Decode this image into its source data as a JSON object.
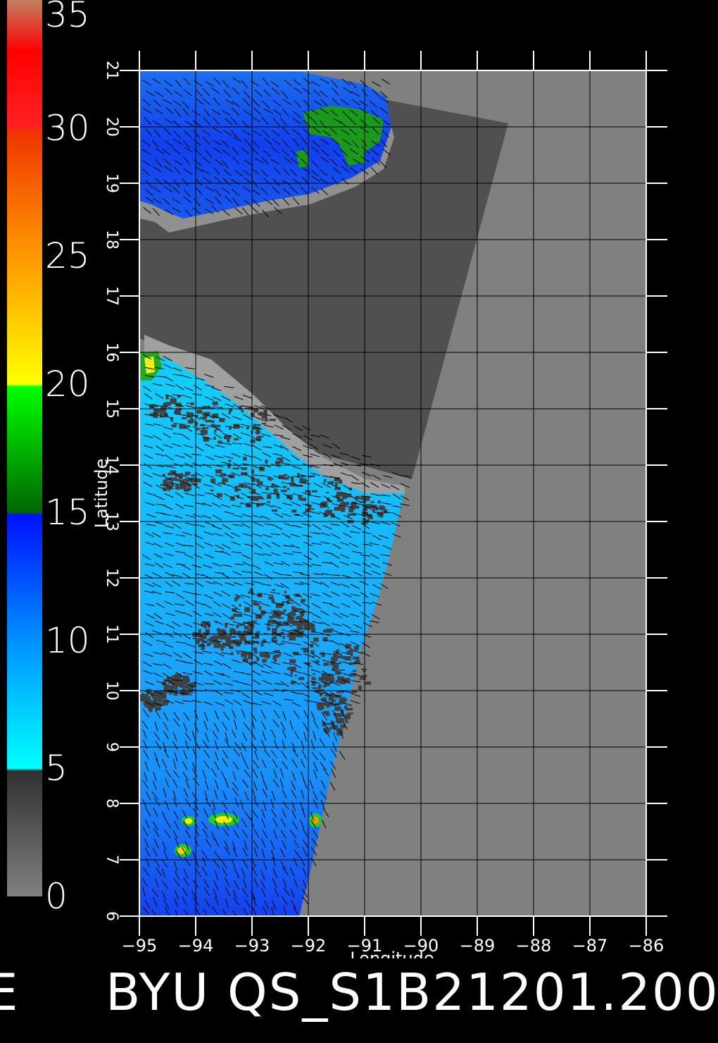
{
  "colorbar": {
    "labels": [
      "35",
      "30",
      "25",
      "20",
      "15",
      "10",
      "5",
      "0"
    ],
    "stops": [
      {
        "value": 0,
        "color": "#808080"
      },
      {
        "value": 4.9,
        "color": "#303030"
      },
      {
        "value": 5,
        "color": "#00ffff"
      },
      {
        "value": 10,
        "color": "#0090ff"
      },
      {
        "value": 14.9,
        "color": "#0010ff"
      },
      {
        "value": 15,
        "color": "#006600"
      },
      {
        "value": 19.9,
        "color": "#00ff00"
      },
      {
        "value": 20,
        "color": "#ffff00"
      },
      {
        "value": 24.9,
        "color": "#ff9900"
      },
      {
        "value": 25,
        "color": "#ff9900"
      },
      {
        "value": 29.9,
        "color": "#ee3300"
      },
      {
        "value": 30,
        "color": "#ff2222"
      },
      {
        "value": 33,
        "color": "#ff0000"
      },
      {
        "value": 35,
        "color": "#c08060"
      }
    ]
  },
  "axes": {
    "xlabel": "Longitude",
    "ylabel": "Latitude",
    "lon_ticks": [
      "-95",
      "-94",
      "-93",
      "-92",
      "-91",
      "-90",
      "-89",
      "-88",
      "-87",
      "-86"
    ],
    "lat_ticks": [
      "6",
      "7",
      "8",
      "9",
      "10",
      "11",
      "12",
      "13",
      "14",
      "15",
      "16",
      "17",
      "18",
      "19",
      "20",
      "21"
    ],
    "lon_range": [
      -95,
      -86
    ],
    "lat_range": [
      6,
      21
    ]
  },
  "colors": {
    "land": "#808080",
    "no_data": "#505050",
    "ocean_low": "#10c8ff",
    "ocean_mid": "#1078f0",
    "ocean_high": "#1040f0",
    "calm": "#404040",
    "grid": "#000000"
  },
  "footer": {
    "left_fragment": "E",
    "title": "BYU  QS_S1B21201.200"
  }
}
